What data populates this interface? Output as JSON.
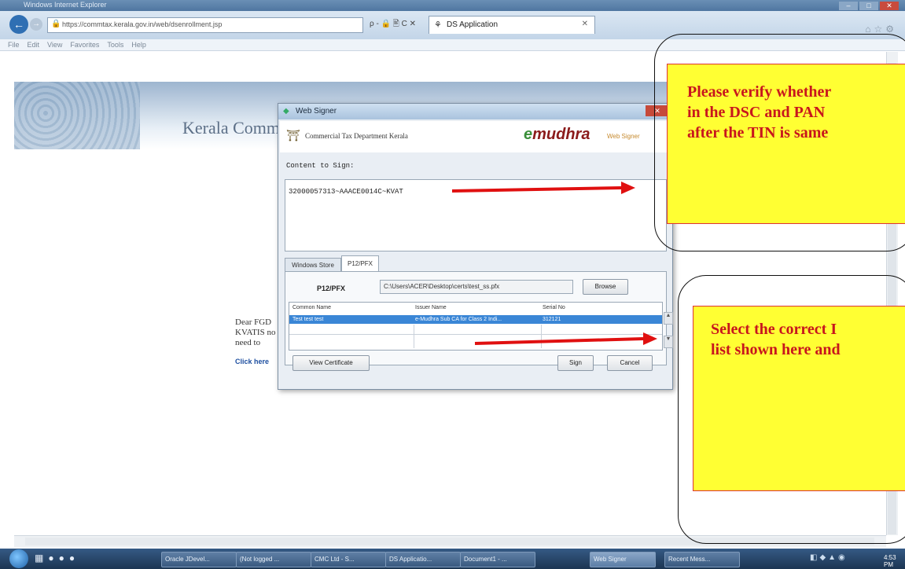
{
  "browser": {
    "window_title": "Windows Internet Explorer",
    "url": "https://commtax.kerala.gov.in/web/dsenrollment.jsp",
    "tab_title": "DS Application",
    "address_tools": "ρ - 🔒 🖹 C ✕",
    "menu": [
      "File",
      "Edit",
      "View",
      "Favorites",
      "Tools",
      "Help"
    ],
    "window_buttons": [
      "–",
      "□",
      "✕"
    ]
  },
  "page": {
    "banner_title": "Kerala Commercial Taxes",
    "dear_text": "Dear FGD KVATIS no need to",
    "click_here": "Click here"
  },
  "dialog": {
    "title": "Web Signer",
    "close_label": "✕",
    "department": "Commercial Tax Department Kerala",
    "brand": "mudhra",
    "brand_e": "e",
    "brand_sub": "Web Signer",
    "content_label": "Content to Sign:",
    "content_value": "32000057313~AAACE0014C~KVAT",
    "tabs": [
      "Windows Store",
      "P12/PFX"
    ],
    "p12_label": "P12/PFX",
    "p12_path": "C:\\Users\\ACER\\Desktop\\certs\\test_ss.pfx",
    "browse_label": "Browse",
    "table_headers": [
      "Common Name",
      "Issuer Name",
      "Serial No"
    ],
    "table_rows": [
      {
        "common_name": "Test test test",
        "issuer_name": "e-Mudhra Sub CA for Class 2 Indi...",
        "serial_no": "312121"
      }
    ],
    "view_certificate_label": "View Certificate",
    "sign_label": "Sign",
    "cancel_label": "Cancel"
  },
  "annotations": {
    "callout_1_lines": [
      "Please verify whether",
      "in the DSC and PAN",
      "after the TIN is same"
    ],
    "callout_2_lines": [
      "Select the correct I",
      "list shown here and"
    ],
    "callout_color": "#c8161d",
    "callout_bg": "#ffff33",
    "arrow_color": "#e01010"
  },
  "taskbar": {
    "items": [
      "Oracle JDevel...",
      "(Not logged ...",
      "CMC Ltd - S...",
      "DS Applicatio...",
      "Document1 - ...",
      "Web Signer",
      "Recent Mess..."
    ],
    "clock": "4:53 PM"
  }
}
